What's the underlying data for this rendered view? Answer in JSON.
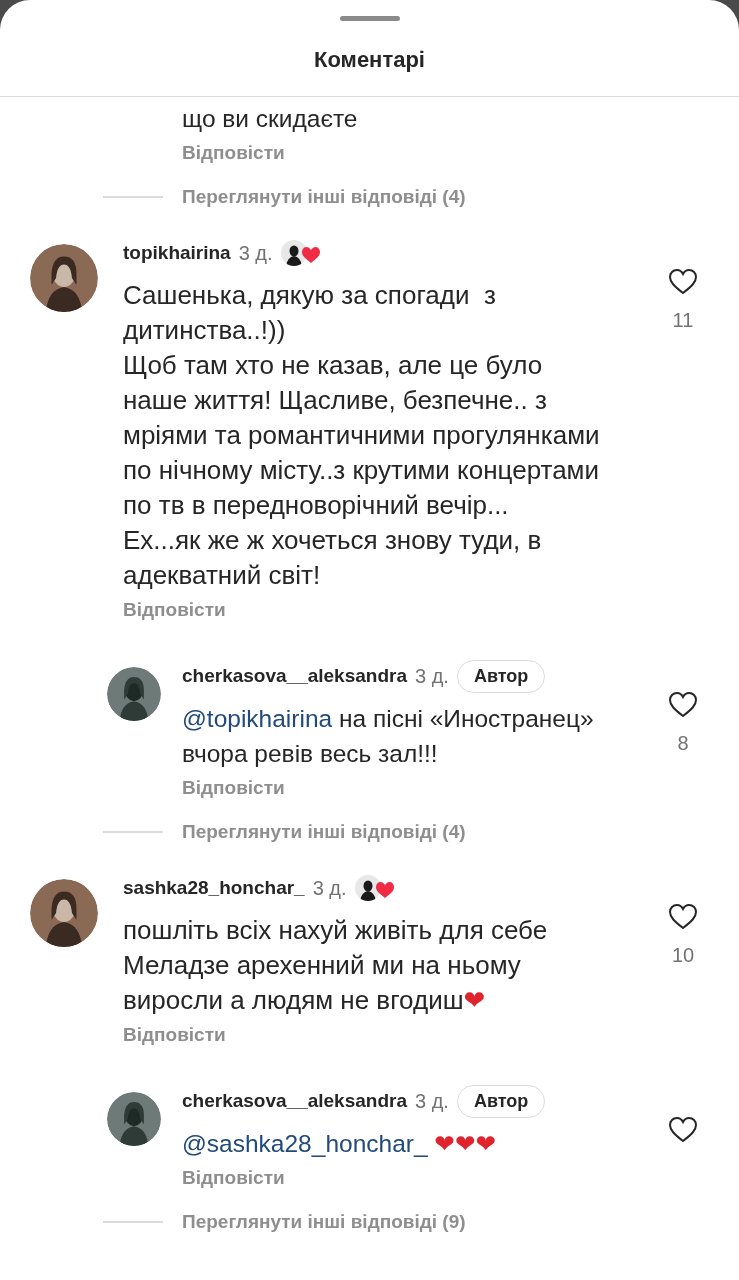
{
  "header": {
    "title": "Коментарі"
  },
  "items": [
    {
      "kind": "tail",
      "text": "що ви скидаєте",
      "reply_label": "Відповісти"
    },
    {
      "kind": "more",
      "label": "Переглянути інші відповіді (4)"
    },
    {
      "kind": "comment",
      "user": "topikhairina",
      "time": "3 д.",
      "liked_by_author": true,
      "text": "Сашенька, дякую за спогади  з дитинства..!))\nЩоб там хто не казав, але це було наше життя! Щасливе, безпечне.. з мріями та романтичними прогулянками по нічному місту..з крутими концертами по тв в передноворічний вечір...\nЕх...як же ж хочеться знову туди, в адекватний світ!",
      "reply_label": "Відповісти",
      "likes": "11"
    },
    {
      "kind": "reply",
      "user": "cherkasova__aleksandra",
      "time": "3 д.",
      "badge": "Автор",
      "liked_by_author": false,
      "mention": "@topikhairina",
      "text": "на пісні «Иностранец» вчора ревів весь зал!!!",
      "reply_label": "Відповісти",
      "likes": "8"
    },
    {
      "kind": "more",
      "label": "Переглянути інші відповіді (4)"
    },
    {
      "kind": "comment",
      "user": "sashka28_honchar_",
      "time": "3 д.",
      "liked_by_author": true,
      "text": "пошліть всіх нахуй живіть для себе Меладзе арехенний ми на ньому виросли а людям не вгодиш❤️",
      "reply_label": "Відповісти",
      "likes": "10"
    },
    {
      "kind": "reply",
      "user": "cherkasova__aleksandra",
      "time": "3 д.",
      "badge": "Автор",
      "liked_by_author": false,
      "mention": "@sashka28_honchar_",
      "text": "❤️❤️❤️",
      "reply_label": "Відповісти"
    },
    {
      "kind": "more",
      "label": "Переглянути інші відповіді (9)"
    }
  ]
}
